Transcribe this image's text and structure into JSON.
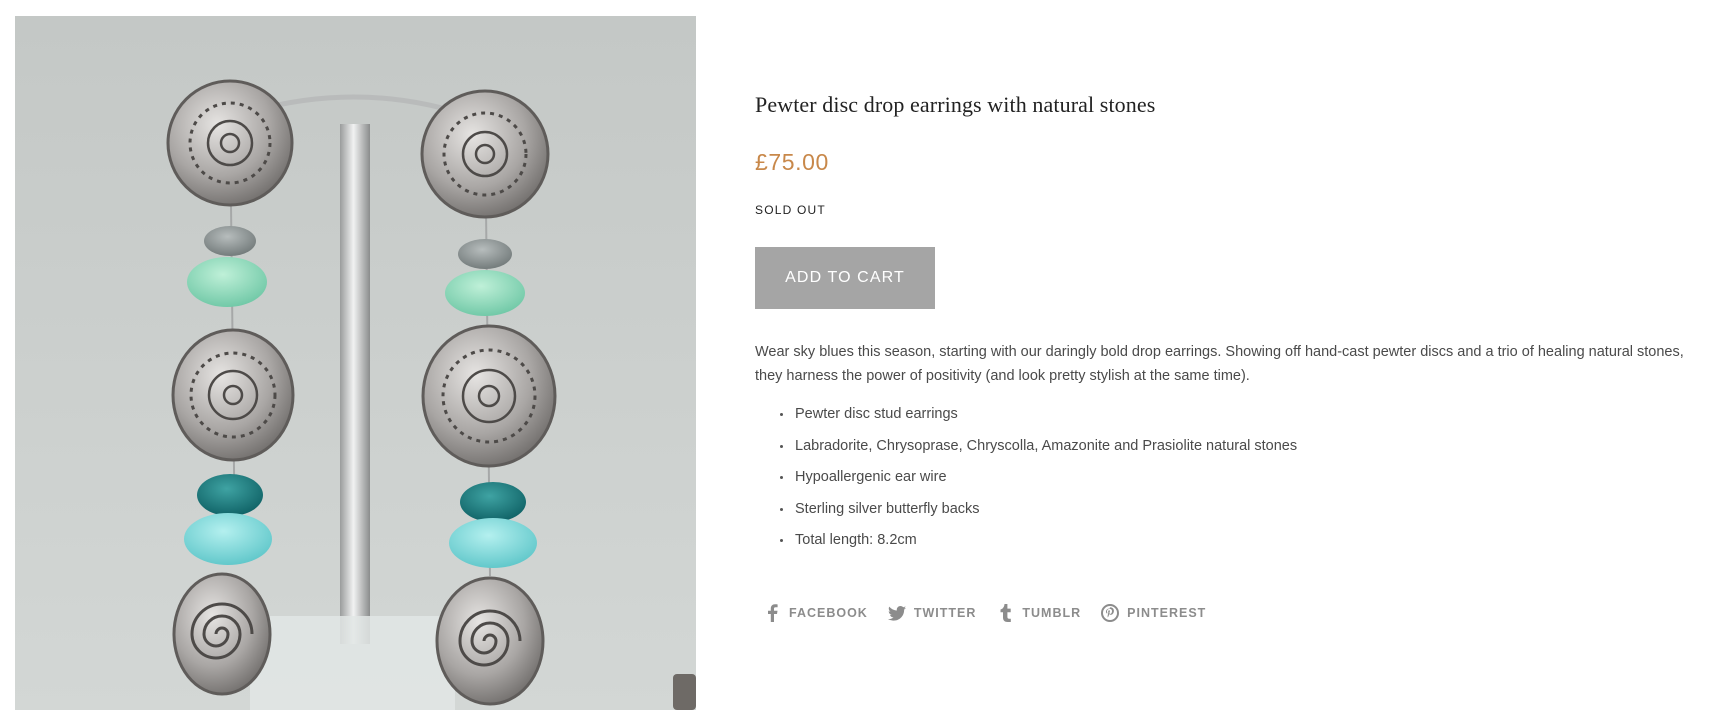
{
  "product": {
    "title": "Pewter disc drop earrings with natural stones",
    "price": "£75.00",
    "stock_status": "SOLD OUT",
    "add_to_cart_label": "ADD TO CART",
    "description": "Wear sky blues this season, starting with our daringly bold drop earrings. Showing off hand-cast pewter discs and a trio of healing natural stones, they harness the power of positivity (and look pretty stylish at the same time).",
    "features": [
      "Pewter disc stud earrings",
      "Labradorite, Chrysoprase, Chryscolla, Amazonite and Prasiolite natural stones",
      "Hypoallergenic ear wire",
      "Sterling silver butterfly backs",
      "Total length: 8.2cm"
    ]
  },
  "social": [
    {
      "label": "FACEBOOK",
      "icon": "facebook-icon"
    },
    {
      "label": "TWITTER",
      "icon": "twitter-icon"
    },
    {
      "label": "TUMBLR",
      "icon": "tumblr-icon"
    },
    {
      "label": "PINTEREST",
      "icon": "pinterest-icon"
    }
  ],
  "colors": {
    "price": "#c8884a",
    "button_bg": "#a5a5a5",
    "social_text": "#8c8c8c"
  }
}
